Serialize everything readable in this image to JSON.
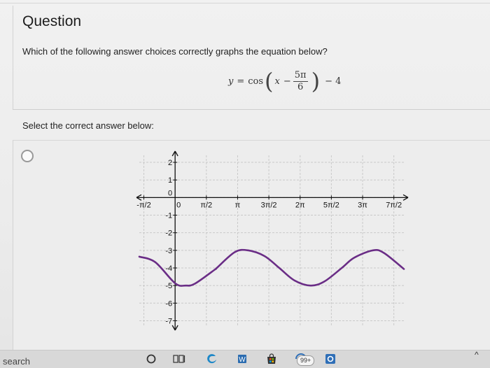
{
  "question": {
    "title": "Question",
    "prompt": "Which of the following answer choices correctly graphs the equation below?",
    "equation": {
      "lhs": "y",
      "func": "cos",
      "var": "x",
      "minus": "−",
      "frac_num": "5π",
      "frac_den": "6",
      "shift": "− 4"
    }
  },
  "select_label": "Select the correct answer below:",
  "answer_option": {
    "selected": false
  },
  "chart_data": {
    "type": "line",
    "title": "",
    "xlabel": "",
    "ylabel": "",
    "xlim": [
      -1.8,
      11.5
    ],
    "ylim": [
      -7.3,
      2.4
    ],
    "x_ticks": [
      {
        "v": -1.5708,
        "label": "-π/2"
      },
      {
        "v": 0,
        "label": "0"
      },
      {
        "v": 1.5708,
        "label": "π/2"
      },
      {
        "v": 3.1416,
        "label": "π"
      },
      {
        "v": 4.7124,
        "label": "3π/2"
      },
      {
        "v": 6.2832,
        "label": "2π"
      },
      {
        "v": 7.854,
        "label": "5π/2"
      },
      {
        "v": 9.4248,
        "label": "3π"
      },
      {
        "v": 10.9956,
        "label": "7π/2"
      }
    ],
    "y_ticks": [
      {
        "v": 2,
        "label": "2"
      },
      {
        "v": 1,
        "label": "1"
      },
      {
        "v": 0,
        "label": "0"
      },
      {
        "v": -1,
        "label": "-1"
      },
      {
        "v": -2,
        "label": "-2"
      },
      {
        "v": -3,
        "label": "-3"
      },
      {
        "v": -4,
        "label": "-4"
      },
      {
        "v": -5,
        "label": "-5"
      },
      {
        "v": -6,
        "label": "-6"
      },
      {
        "v": -7,
        "label": "-7"
      }
    ],
    "grid": true,
    "series": [
      {
        "color": "#6a2d86",
        "x": [
          -1.8,
          -1.0,
          0.0,
          0.5236,
          1.0,
          2.0,
          2.0944,
          3.0,
          3.6652,
          4.5,
          5.236,
          6.0,
          6.8068,
          7.5,
          8.3776,
          9.0,
          9.9484,
          10.5,
          11.5
        ],
        "y": [
          -3.36,
          -3.67,
          -4.87,
          -5.0,
          -4.89,
          -4.09,
          -4.0,
          -3.1,
          -3.0,
          -3.33,
          -4.0,
          -4.71,
          -5.0,
          -4.77,
          -4.0,
          -3.42,
          -3.0,
          -3.15,
          -4.06
        ]
      }
    ]
  },
  "taskbar": {
    "search_label": "search",
    "badge_count": "99+",
    "colors": {
      "edge": "#1e88c8",
      "word": "#2b6cb0",
      "store": "#333333",
      "app": "#2f6fb7"
    }
  }
}
